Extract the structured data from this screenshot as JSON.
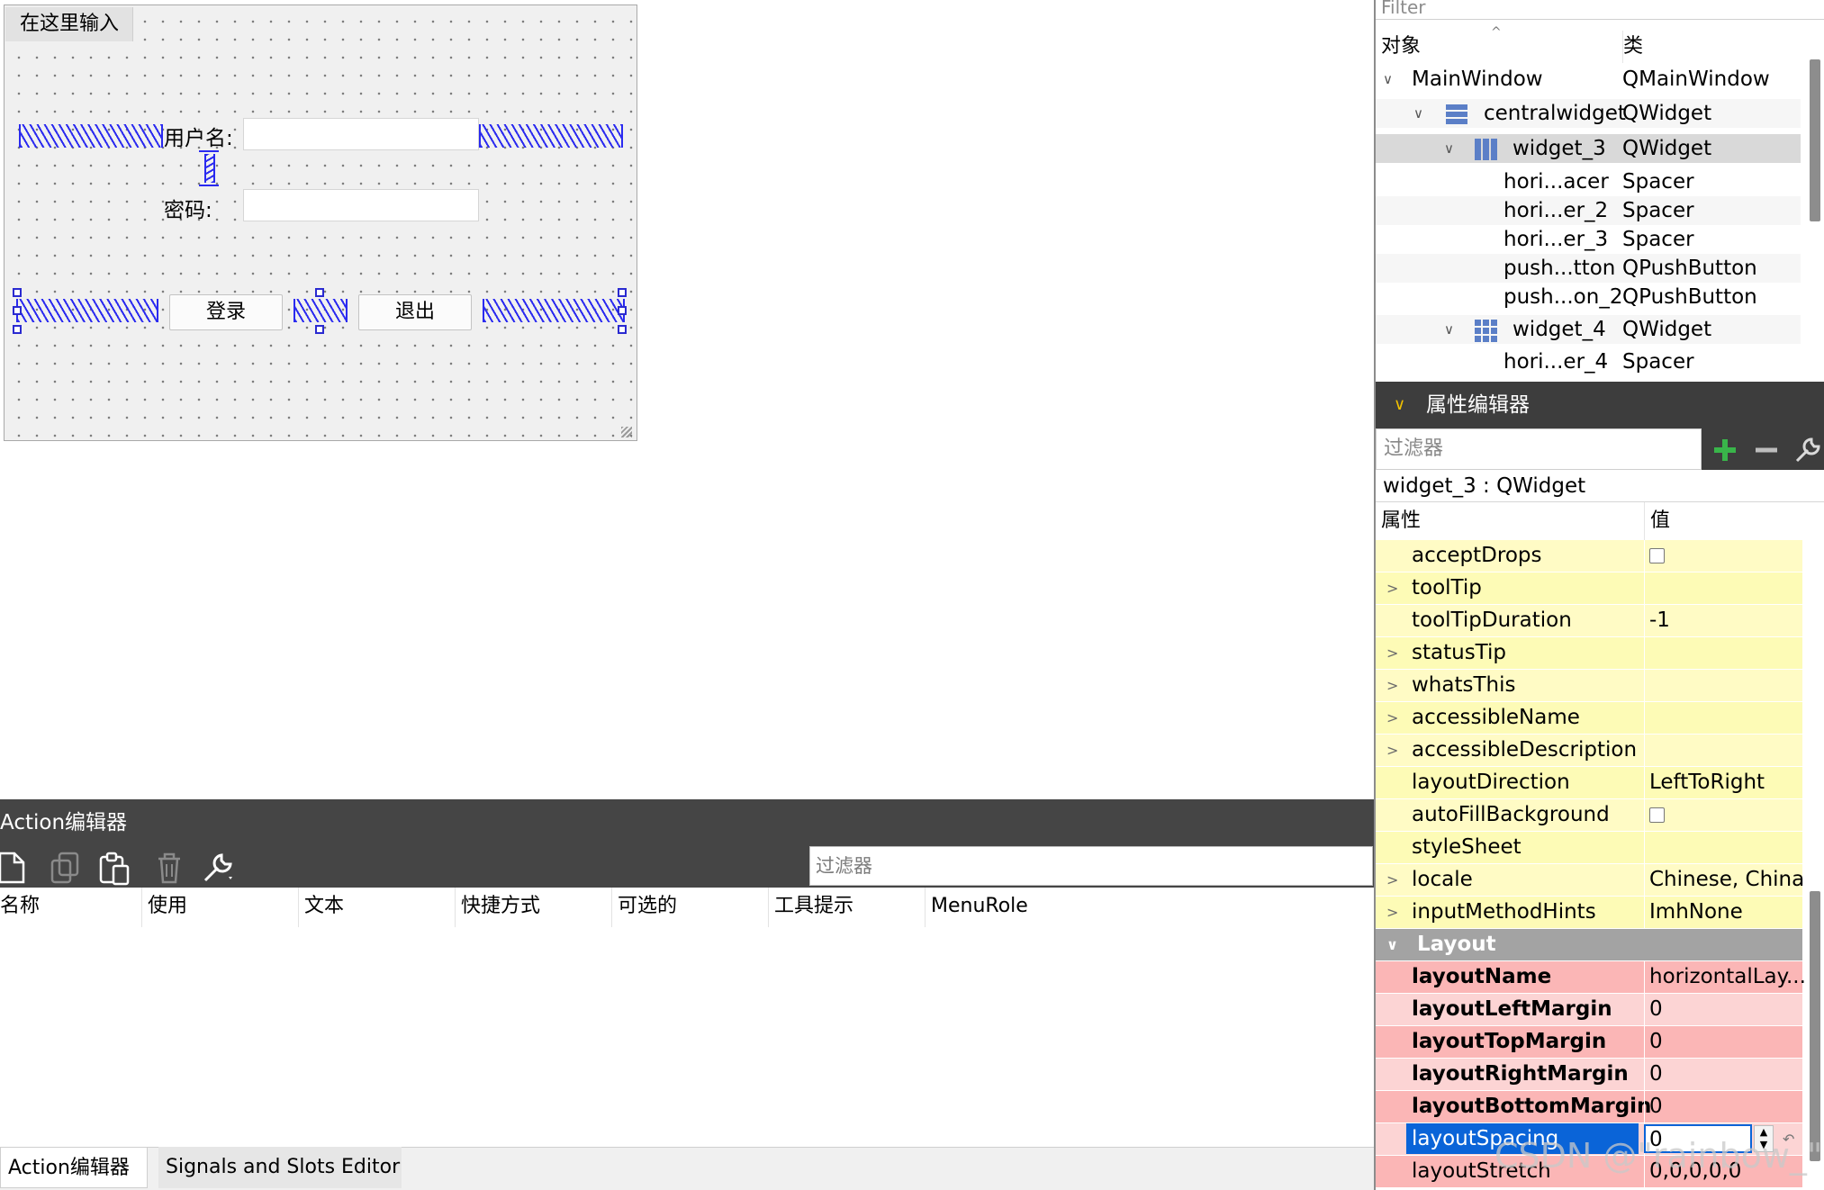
{
  "form": {
    "menu_placeholder": "在这里输入",
    "username_label": "用户名:",
    "password_label": "密码:",
    "login_button": "登录",
    "exit_button": "退出"
  },
  "action_editor": {
    "title": "Action编辑器",
    "filter_placeholder": "过滤器",
    "columns": [
      "名称",
      "使用",
      "文本",
      "快捷方式",
      "可选的",
      "工具提示",
      "MenuRole"
    ],
    "toolbar_icons": [
      "new-document-icon",
      "copy-icon",
      "paste-icon",
      "delete-icon",
      "wrench-icon"
    ]
  },
  "bottom_tabs": [
    "Action编辑器",
    "Signals and Slots Editor"
  ],
  "object_inspector": {
    "filter_placeholder": "Filter",
    "col_object": "对象",
    "col_class": "类",
    "rows": [
      {
        "name": "MainWindow",
        "cls": "QMainWindow"
      },
      {
        "name": "centralwidget",
        "cls": "QWidget"
      },
      {
        "name": "widget_3",
        "cls": "QWidget"
      },
      {
        "name": "hori...acer",
        "cls": "Spacer"
      },
      {
        "name": "hori...er_2",
        "cls": "Spacer"
      },
      {
        "name": "hori...er_3",
        "cls": "Spacer"
      },
      {
        "name": "push...tton",
        "cls": "QPushButton"
      },
      {
        "name": "push...on_2",
        "cls": "QPushButton"
      },
      {
        "name": "widget_4",
        "cls": "QWidget"
      },
      {
        "name": "hori...er_4",
        "cls": "Spacer"
      }
    ]
  },
  "property_editor": {
    "title": "属性编辑器",
    "filter_placeholder": "过滤器",
    "object_line": "widget_3 : QWidget",
    "col_property": "属性",
    "col_value": "值",
    "section_layout": "Layout",
    "rows": [
      {
        "name": "acceptDrops",
        "value": ""
      },
      {
        "name": "toolTip",
        "value": ""
      },
      {
        "name": "toolTipDuration",
        "value": "-1"
      },
      {
        "name": "statusTip",
        "value": ""
      },
      {
        "name": "whatsThis",
        "value": ""
      },
      {
        "name": "accessibleName",
        "value": ""
      },
      {
        "name": "accessibleDescription",
        "value": ""
      },
      {
        "name": "layoutDirection",
        "value": "LeftToRight"
      },
      {
        "name": "autoFillBackground",
        "value": ""
      },
      {
        "name": "styleSheet",
        "value": ""
      },
      {
        "name": "locale",
        "value": "Chinese, China"
      },
      {
        "name": "inputMethodHints",
        "value": "ImhNone"
      }
    ],
    "layout_rows": [
      {
        "name": "layoutName",
        "value": "horizontalLay..."
      },
      {
        "name": "layoutLeftMargin",
        "value": "0"
      },
      {
        "name": "layoutTopMargin",
        "value": "0"
      },
      {
        "name": "layoutRightMargin",
        "value": "0"
      },
      {
        "name": "layoutBottomMargin",
        "value": "0"
      },
      {
        "name": "layoutSpacing",
        "value": "0"
      },
      {
        "name": "layoutStretch",
        "value": "0,0,0,0,0"
      }
    ]
  },
  "watermark": "CSDN @\"rainbow_\"",
  "colors": {
    "spacer_blue": "#2a2af0",
    "dark_panel": "#454545",
    "property_yellow": "#fffbc5",
    "layout_red": "#fbb6b6",
    "selection_blue": "#0a64d8",
    "plus_green": "#39b54a"
  }
}
